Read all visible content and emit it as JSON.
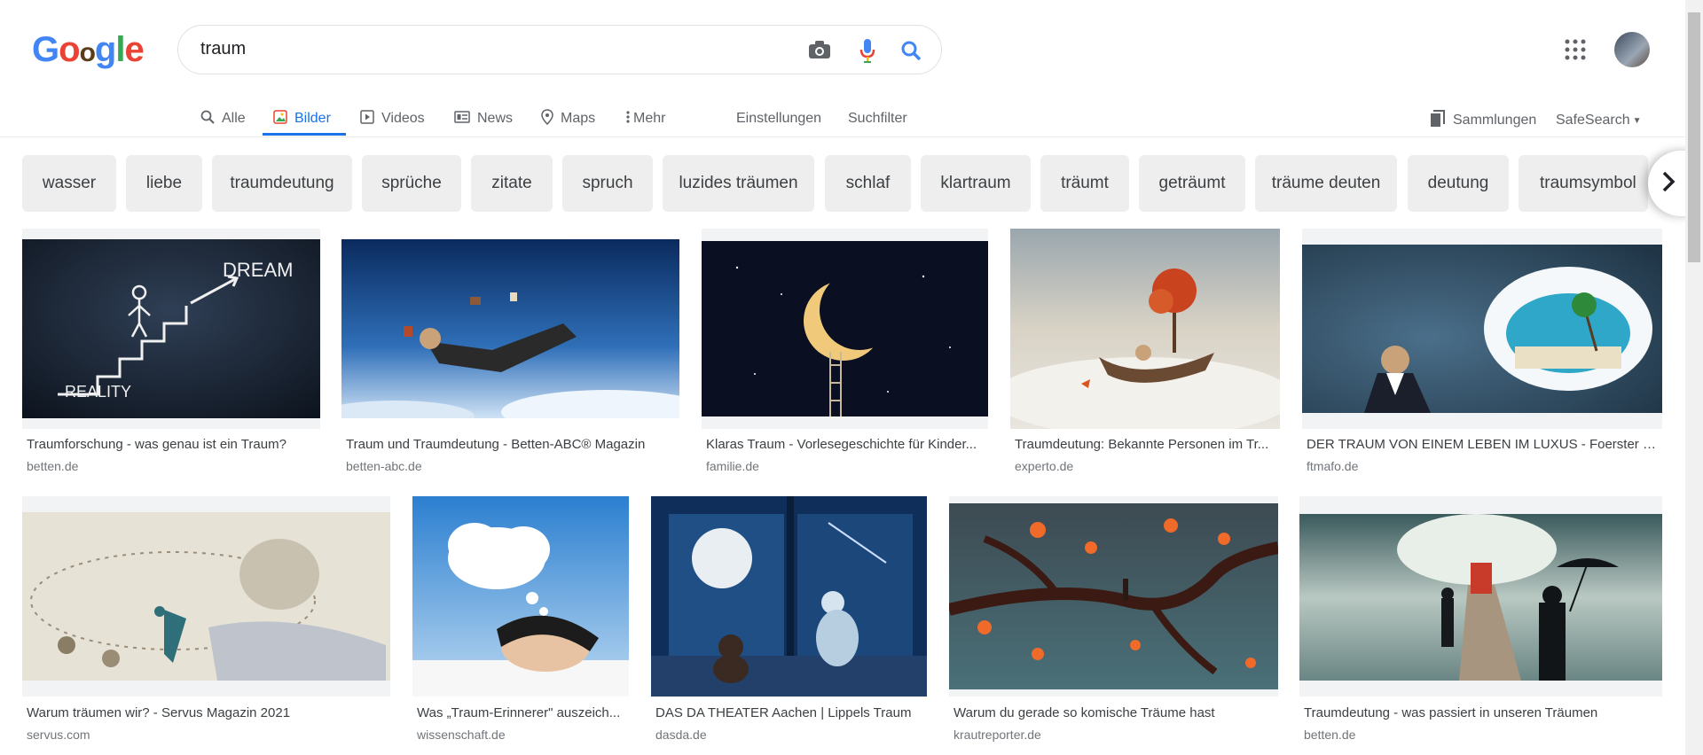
{
  "header": {
    "logo_letters": [
      "G",
      "o",
      "o",
      "g",
      "l",
      "e"
    ],
    "query": "traum",
    "icons": [
      "camera-icon",
      "mic-icon",
      "search-icon",
      "apps-icon",
      "avatar"
    ]
  },
  "tabs": [
    {
      "label": "Alle",
      "icon": "search-icon"
    },
    {
      "label": "Bilder",
      "icon": "image-icon",
      "active": true
    },
    {
      "label": "Videos",
      "icon": "play-icon"
    },
    {
      "label": "News",
      "icon": "news-icon"
    },
    {
      "label": "Maps",
      "icon": "pin-icon"
    },
    {
      "label": "Mehr",
      "icon": "more-icon"
    }
  ],
  "tools": {
    "settings": "Einstellungen",
    "filter": "Suchfilter",
    "collections": "Sammlungen",
    "safesearch": "SafeSearch"
  },
  "chips": [
    "wasser",
    "liebe",
    "traumdeutung",
    "sprüche",
    "zitate",
    "spruch",
    "luzides träumen",
    "schlaf",
    "klartraum",
    "träumt",
    "geträumt",
    "träume deuten",
    "deutung",
    "traumsymbol"
  ],
  "results": [
    {
      "title": "Traumforschung - was genau ist ein Traum?",
      "source": "betten.de"
    },
    {
      "title": "Traum und Traumdeutung - Betten-ABC® Magazin",
      "source": "betten-abc.de"
    },
    {
      "title": "Klaras Traum - Vorlesegeschichte für Kinder...",
      "source": "familie.de"
    },
    {
      "title": "Traumdeutung: Bekannte Personen im Tr...",
      "source": "experto.de"
    },
    {
      "title": "DER TRAUM VON EINEM LEBEN IM LUXUS - Foerster & ...",
      "source": "ftmafo.de"
    },
    {
      "title": "Warum träumen wir? - Servus Magazin 2021",
      "source": "servus.com"
    },
    {
      "title": "Was „Traum-Erinnerer\" auszeich...",
      "source": "wissenschaft.de"
    },
    {
      "title": "DAS DA THEATER Aachen | Lippels Traum",
      "source": "dasda.de"
    },
    {
      "title": "Warum du gerade so komische Träume hast",
      "source": "krautreporter.de"
    },
    {
      "title": "Traumdeutung - was passiert in unseren Träumen",
      "source": "betten.de"
    }
  ],
  "image_texts": {
    "reality": "REALITY",
    "dream": "DREAM"
  },
  "colors": {
    "blue": "#1a73e8",
    "red": "#ea4335",
    "yellow": "#fbbc04",
    "green": "#34a853",
    "chip_bg": "#eeeeee"
  }
}
